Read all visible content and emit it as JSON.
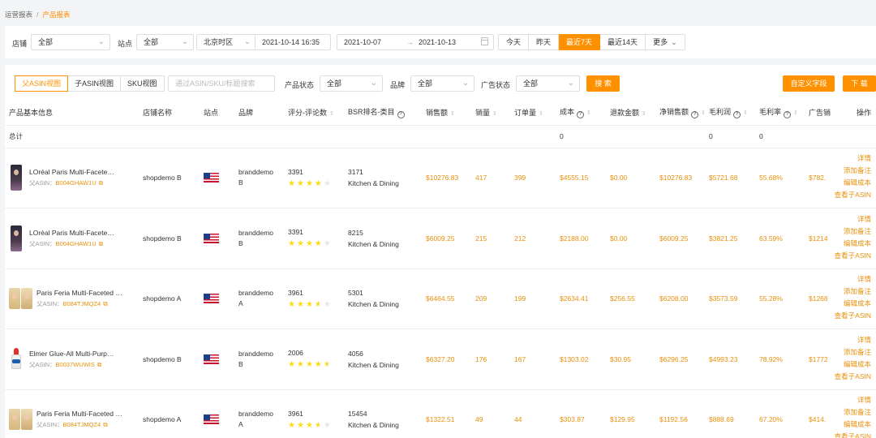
{
  "breadcrumb": {
    "parent": "运营报表",
    "separator": "/",
    "current": "产品报表"
  },
  "filters": {
    "store_label": "店铺",
    "store_value": "全部",
    "site_label": "站点",
    "site_value": "全部",
    "timezone_value": "北京时区",
    "datetime_value": "2021-10-14 16:35",
    "date_start": "2021-10-07",
    "date_arrow": "→",
    "date_end": "2021-10-13",
    "quick": [
      "今天",
      "昨天",
      "最近7天",
      "最近14天",
      "更多"
    ],
    "quick_active": 2
  },
  "toolbar": {
    "views": [
      "父ASIN视图",
      "子ASIN视图",
      "SKU视图"
    ],
    "search_placeholder": "通过ASIN/SKU/标题搜索",
    "status_label": "产品状态",
    "status_value": "全部",
    "brand_label": "品牌",
    "brand_value": "全部",
    "ad_status_label": "广告状态",
    "ad_status_value": "全部",
    "search_button": "搜 索",
    "custom_fields_button": "自定义字段",
    "download_button": "下 载"
  },
  "table": {
    "headers": [
      "产品基本信息",
      "店铺名称",
      "站点",
      "品牌",
      "评分-评论数",
      "BSR排名-类目",
      "销售额",
      "销量",
      "订单量",
      "成本",
      "退款金额",
      "净销售额",
      "毛利润",
      "毛利率",
      "广告销",
      "操作"
    ],
    "total": {
      "label": "总计",
      "cost": "0",
      "gross_profit": "0",
      "gross_margin": "0"
    },
    "asin_label": "父ASIN：",
    "rows": [
      {
        "title": "LOréal Paris Multi-Faceted Shimmering Colour",
        "asin": "B004GHAW1U",
        "store": "shopdemo B",
        "brand": "branddemo B",
        "rating": "3391",
        "stars": 4,
        "bsr": "3171",
        "category": "Kitchen & Dining",
        "sales": "$10276.83",
        "units": "417",
        "orders": "399",
        "cost": "$4555.15",
        "refund": "$0.00",
        "net_sales": "$10276.83",
        "gross_profit": "$5721.68",
        "gross_margin": "55.68%",
        "ad_sales": "$782.",
        "thumb": "dark"
      },
      {
        "title": "LOréal Paris Multi-Faceted Shimmering Colour",
        "asin": "B004GHAW1U",
        "store": "shopdemo B",
        "brand": "branddemo B",
        "rating": "3391",
        "stars": 4,
        "bsr": "8215",
        "category": "Kitchen & Dining",
        "sales": "$6009.25",
        "units": "215",
        "orders": "212",
        "cost": "$2188.00",
        "refund": "$0.00",
        "net_sales": "$6009.25",
        "gross_profit": "$3821.25",
        "gross_margin": "63.59%",
        "ad_sales": "$1214",
        "thumb": "dark"
      },
      {
        "title": "Paris Feria Multi-Faceted Shimmering Colour",
        "asin": "B084TJMQZ4",
        "store": "shopdemo A",
        "brand": "branddemo A",
        "rating": "3961",
        "stars": 3.5,
        "bsr": "5301",
        "category": "Kitchen & Dining",
        "sales": "$6464.55",
        "units": "209",
        "orders": "199",
        "cost": "$2634.41",
        "refund": "$256.55",
        "net_sales": "$6208.00",
        "gross_profit": "$3573.59",
        "gross_margin": "55.28%",
        "ad_sales": "$1268",
        "thumb": "blonde"
      },
      {
        "title": "Elmer Glue-All Multi-Purpose Liquid Glue",
        "asin": "B0037WUWIS",
        "store": "shopdemo B",
        "brand": "branddemo B",
        "rating": "2006",
        "stars": 4.5,
        "bsr": "4056",
        "category": "Kitchen & Dining",
        "sales": "$6327.20",
        "units": "176",
        "orders": "167",
        "cost": "$1303.02",
        "refund": "$30.95",
        "net_sales": "$6296.25",
        "gross_profit": "$4993.23",
        "gross_margin": "78.92%",
        "ad_sales": "$1772",
        "thumb": "glue"
      },
      {
        "title": "Paris Feria Multi-Faceted Shimmering Colour",
        "asin": "B084TJMQZ4",
        "store": "shopdemo A",
        "brand": "branddemo A",
        "rating": "3961",
        "stars": 3.5,
        "bsr": "15454",
        "category": "Kitchen & Dining",
        "sales": "$1322.51",
        "units": "49",
        "orders": "44",
        "cost": "$303.87",
        "refund": "$129.95",
        "net_sales": "$1192.56",
        "gross_profit": "$888.69",
        "gross_margin": "67.20%",
        "ad_sales": "$414.",
        "thumb": "blonde"
      }
    ],
    "ops": [
      "详情",
      "添加备注",
      "编辑成本",
      "查看子ASIN"
    ]
  }
}
